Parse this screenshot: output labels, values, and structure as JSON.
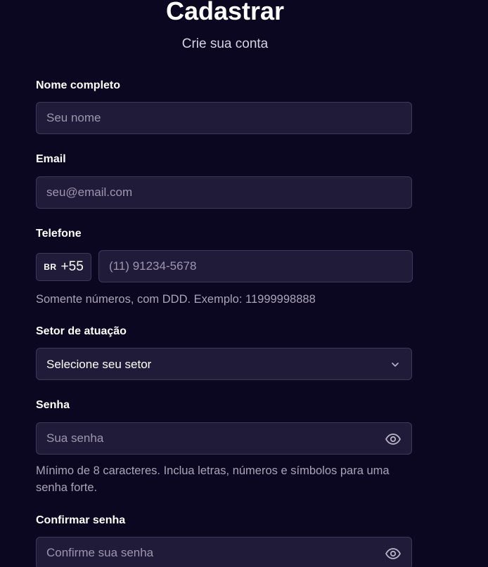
{
  "header": {
    "title": "Cadastrar",
    "subtitle": "Crie sua conta"
  },
  "form": {
    "name": {
      "label": "Nome completo",
      "placeholder": "Seu nome",
      "value": ""
    },
    "email": {
      "label": "Email",
      "placeholder": "seu@email.com",
      "value": ""
    },
    "phone": {
      "label": "Telefone",
      "country_code": "BR",
      "dial_code": "+55",
      "placeholder": "(11) 91234-5678",
      "value": "",
      "hint": "Somente números, com DDD. Exemplo: 11999998888"
    },
    "sector": {
      "label": "Setor de atuação",
      "selected": "Selecione seu setor",
      "icon": "chevron-down-icon"
    },
    "password": {
      "label": "Senha",
      "placeholder": "Sua senha",
      "value": "",
      "hint": "Mínimo de 8 caracteres. Inclua letras, números e símbolos para uma senha forte.",
      "toggle_icon": "eye-icon"
    },
    "confirm_password": {
      "label": "Confirmar senha",
      "placeholder": "Confirme sua senha",
      "value": "",
      "toggle_icon": "eye-icon"
    }
  },
  "colors": {
    "background": "#0b0720",
    "field_background": "#211b3a",
    "field_border": "#3f3858",
    "placeholder": "#9c97ad",
    "hint": "#a9a4b9"
  }
}
